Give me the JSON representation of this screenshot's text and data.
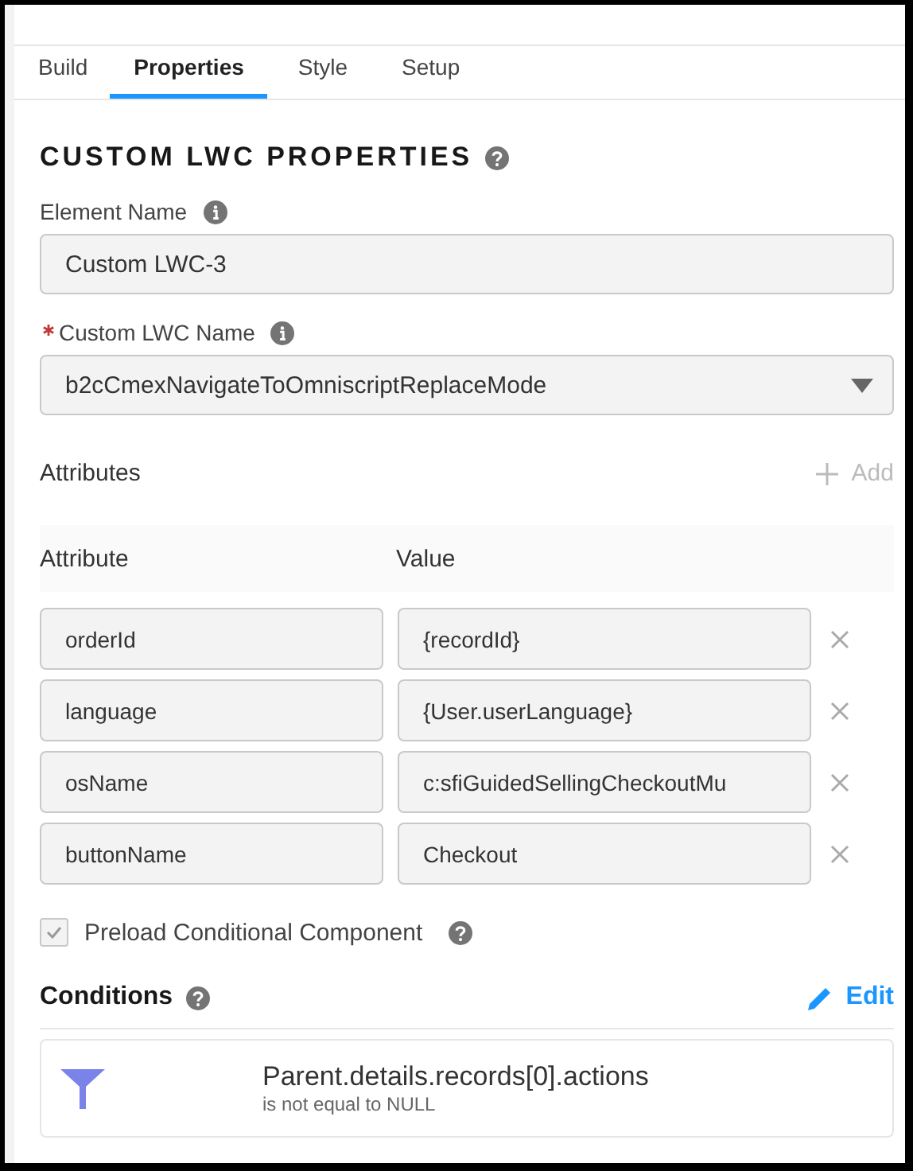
{
  "tabs": [
    {
      "label": "Build",
      "selected": false
    },
    {
      "label": "Properties",
      "selected": true
    },
    {
      "label": "Style",
      "selected": false
    },
    {
      "label": "Setup",
      "selected": false
    }
  ],
  "heading": "CUSTOM LWC PROPERTIES",
  "element_name": {
    "label": "Element Name",
    "value": "Custom LWC-3"
  },
  "lwc_name": {
    "label": "Custom LWC Name",
    "required": true,
    "value": "b2cCmexNavigateToOmniscriptReplaceMode"
  },
  "attributes": {
    "title": "Attributes",
    "add": "Add",
    "columns": [
      "Attribute",
      "Value"
    ],
    "rows": [
      {
        "attribute": "orderId",
        "value": "{recordId}"
      },
      {
        "attribute": "language",
        "value": "{User.userLanguage}"
      },
      {
        "attribute": "osName",
        "value": "c:sfiGuidedSellingCheckoutMu"
      },
      {
        "attribute": "buttonName",
        "value": "Checkout"
      }
    ]
  },
  "preload": {
    "label": "Preload Conditional Component",
    "checked": true
  },
  "conditions": {
    "title": "Conditions",
    "edit": "Edit",
    "items": [
      {
        "field": "Parent.details.records[0].actions",
        "operator": "is not equal to NULL"
      }
    ]
  }
}
